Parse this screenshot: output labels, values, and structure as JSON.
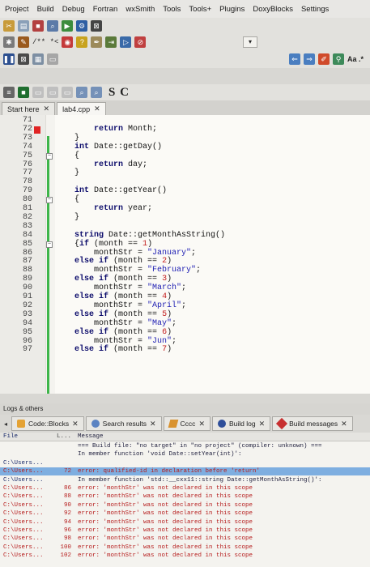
{
  "menu": [
    "Project",
    "Build",
    "Debug",
    "Fortran",
    "wxSmith",
    "Tools",
    "Tools+",
    "Plugins",
    "DoxyBlocks",
    "Settings"
  ],
  "toolbar": {
    "comment_text": "/** *<",
    "sc_label": "S C",
    "regex_label": "Aa .*"
  },
  "colors": {
    "error_text": "#b61d1d",
    "changed_line": "#3eb54a",
    "breakpoint": "#e02424",
    "selection": "#7eaee0"
  },
  "editor": {
    "tabs": [
      {
        "label": "Start here"
      },
      {
        "label": "lab4.cpp"
      }
    ],
    "lines": [
      {
        "n": "71",
        "code": "",
        "fold": ""
      },
      {
        "n": "72",
        "code": "    return Month;",
        "fold": "",
        "marker": "red"
      },
      {
        "n": "73",
        "code": "}",
        "fold": ""
      },
      {
        "n": "74",
        "code": "int Date::getDay()",
        "fold": ""
      },
      {
        "n": "75",
        "code": "{",
        "fold": "⊟"
      },
      {
        "n": "76",
        "code": "    return day;",
        "fold": ""
      },
      {
        "n": "77",
        "code": "}",
        "fold": ""
      },
      {
        "n": "78",
        "code": "",
        "fold": ""
      },
      {
        "n": "79",
        "code": "int Date::getYear()",
        "fold": ""
      },
      {
        "n": "80",
        "code": "{",
        "fold": "⊟"
      },
      {
        "n": "81",
        "code": "    return year;",
        "fold": ""
      },
      {
        "n": "82",
        "code": "}",
        "fold": ""
      },
      {
        "n": "83",
        "code": "",
        "fold": ""
      },
      {
        "n": "84",
        "code": "string Date::getMonthAsString()",
        "fold": ""
      },
      {
        "n": "85",
        "code": "{if (month == 1)",
        "fold": "⊟"
      },
      {
        "n": "86",
        "code": "    monthStr = \"January\";",
        "fold": ""
      },
      {
        "n": "87",
        "code": "else if (month == 2)",
        "fold": ""
      },
      {
        "n": "88",
        "code": "    monthStr = \"February\";",
        "fold": ""
      },
      {
        "n": "89",
        "code": "else if (month == 3)",
        "fold": ""
      },
      {
        "n": "90",
        "code": "    monthStr = \"March\";",
        "fold": ""
      },
      {
        "n": "91",
        "code": "else if (month == 4)",
        "fold": ""
      },
      {
        "n": "92",
        "code": "    monthStr = \"April\";",
        "fold": ""
      },
      {
        "n": "93",
        "code": "else if (month == 5)",
        "fold": ""
      },
      {
        "n": "94",
        "code": "    monthStr = \"May\";",
        "fold": ""
      },
      {
        "n": "95",
        "code": "else if (month == 6)",
        "fold": ""
      },
      {
        "n": "96",
        "code": "    monthStr = \"Jun\";",
        "fold": ""
      },
      {
        "n": "97",
        "code": "else if (month == 7)",
        "fold": ""
      }
    ]
  },
  "logs": {
    "title": "Logs & others",
    "tabs": [
      {
        "label": "Code::Blocks"
      },
      {
        "label": "Search results"
      },
      {
        "label": "Cccc"
      },
      {
        "label": "Build log"
      },
      {
        "label": "Build messages"
      }
    ],
    "columns": {
      "file": "File",
      "line": "L...",
      "message": "Message"
    },
    "rows": [
      {
        "file": "",
        "line": "",
        "message": "=== Build file: \"no target\" in \"no project\" (compiler: unknown) ===",
        "type": "info"
      },
      {
        "file": "",
        "line": "",
        "message": "In member function 'void Date::setYear(int)':",
        "type": "info"
      },
      {
        "file": "C:\\Users...",
        "line": "",
        "message": "",
        "type": "info"
      },
      {
        "file": "C:\\Users...",
        "line": "72",
        "message": "error: qualified-id in declaration before 'return'",
        "type": "sel"
      },
      {
        "file": "C:\\Users...",
        "line": "",
        "message": "In member function 'std::__cxx11::string Date::getMonthAsString()':",
        "type": "info"
      },
      {
        "file": "C:\\Users...",
        "line": "86",
        "message": "error: 'monthStr' was not declared in this scope",
        "type": "err"
      },
      {
        "file": "C:\\Users...",
        "line": "88",
        "message": "error: 'monthStr' was not declared in this scope",
        "type": "err"
      },
      {
        "file": "C:\\Users...",
        "line": "90",
        "message": "error: 'monthStr' was not declared in this scope",
        "type": "err"
      },
      {
        "file": "C:\\Users...",
        "line": "92",
        "message": "error: 'monthStr' was not declared in this scope",
        "type": "err"
      },
      {
        "file": "C:\\Users...",
        "line": "94",
        "message": "error: 'monthStr' was not declared in this scope",
        "type": "err"
      },
      {
        "file": "C:\\Users...",
        "line": "96",
        "message": "error: 'monthStr' was not declared in this scope",
        "type": "err"
      },
      {
        "file": "C:\\Users...",
        "line": "98",
        "message": "error: 'monthStr' was not declared in this scope",
        "type": "err"
      },
      {
        "file": "C:\\Users...",
        "line": "100",
        "message": "error: 'monthStr' was not declared in this scope",
        "type": "err"
      },
      {
        "file": "C:\\Users...",
        "line": "102",
        "message": "error: 'monthStr' was not declared in this scope",
        "type": "err"
      }
    ]
  }
}
